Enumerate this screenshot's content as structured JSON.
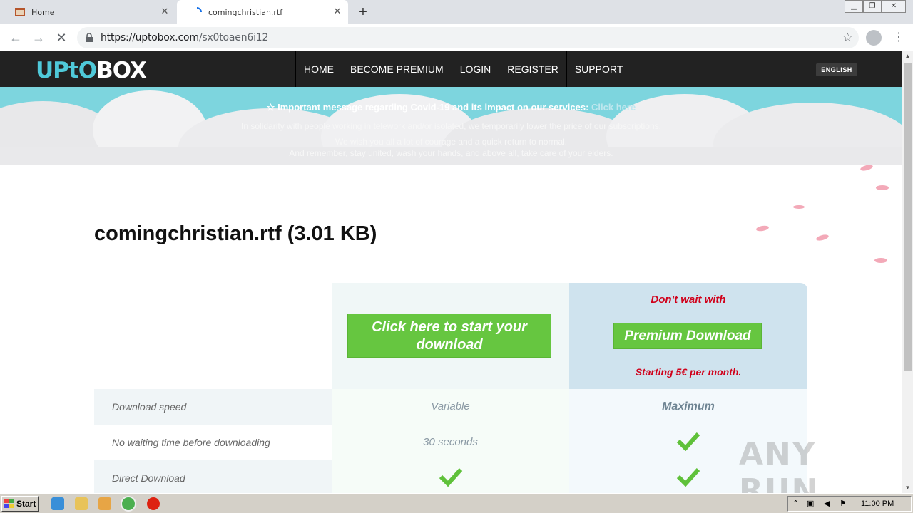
{
  "browser": {
    "tabs": [
      {
        "title": "Home",
        "active": false
      },
      {
        "title": "comingchristian.rtf",
        "active": true
      }
    ],
    "url_host": "https://uptobox.com",
    "url_path": "/sx0toaen6i12"
  },
  "site": {
    "logo_part1": "UPtO",
    "logo_part2": "BOX",
    "nav": [
      "HOME",
      "BECOME PREMIUM",
      "LOGIN",
      "REGISTER",
      "SUPPORT"
    ],
    "language": "ENGLISH",
    "banner": {
      "notice": "Important message regarding Covid-19 and its impact on our services:",
      "notice_link": "Click here",
      "line1": "In solidarity with people working in telework and/or isolated, we temporarily lower the price of our subscriptions.",
      "line2": "We wish you all a lot of courage and a quick return to normal.",
      "line3": "And remember, stay united, wash your hands, and above all, take care of your elders."
    }
  },
  "file": {
    "title": "comingchristian.rtf (3.01 KB)"
  },
  "offer": {
    "free_button": "Click here to start your download",
    "premium_top": "Don't wait with",
    "premium_button": "Premium Download",
    "premium_bottom": "Starting 5€ per month."
  },
  "comparison": [
    {
      "label": "Download speed",
      "free": "Variable",
      "premium": "Maximum"
    },
    {
      "label": "No waiting time before downloading",
      "free": "30 seconds",
      "premium": "check"
    },
    {
      "label": "Direct Download",
      "free": "check",
      "premium": "check"
    }
  ],
  "taskbar": {
    "start": "Start",
    "clock": "11:00 PM"
  },
  "watermark": "ANY RUN",
  "colors": {
    "accent_green": "#66c640",
    "premium_red": "#d0021b",
    "nav_bg": "#222222",
    "logo_cyan": "#4fc9d9"
  }
}
